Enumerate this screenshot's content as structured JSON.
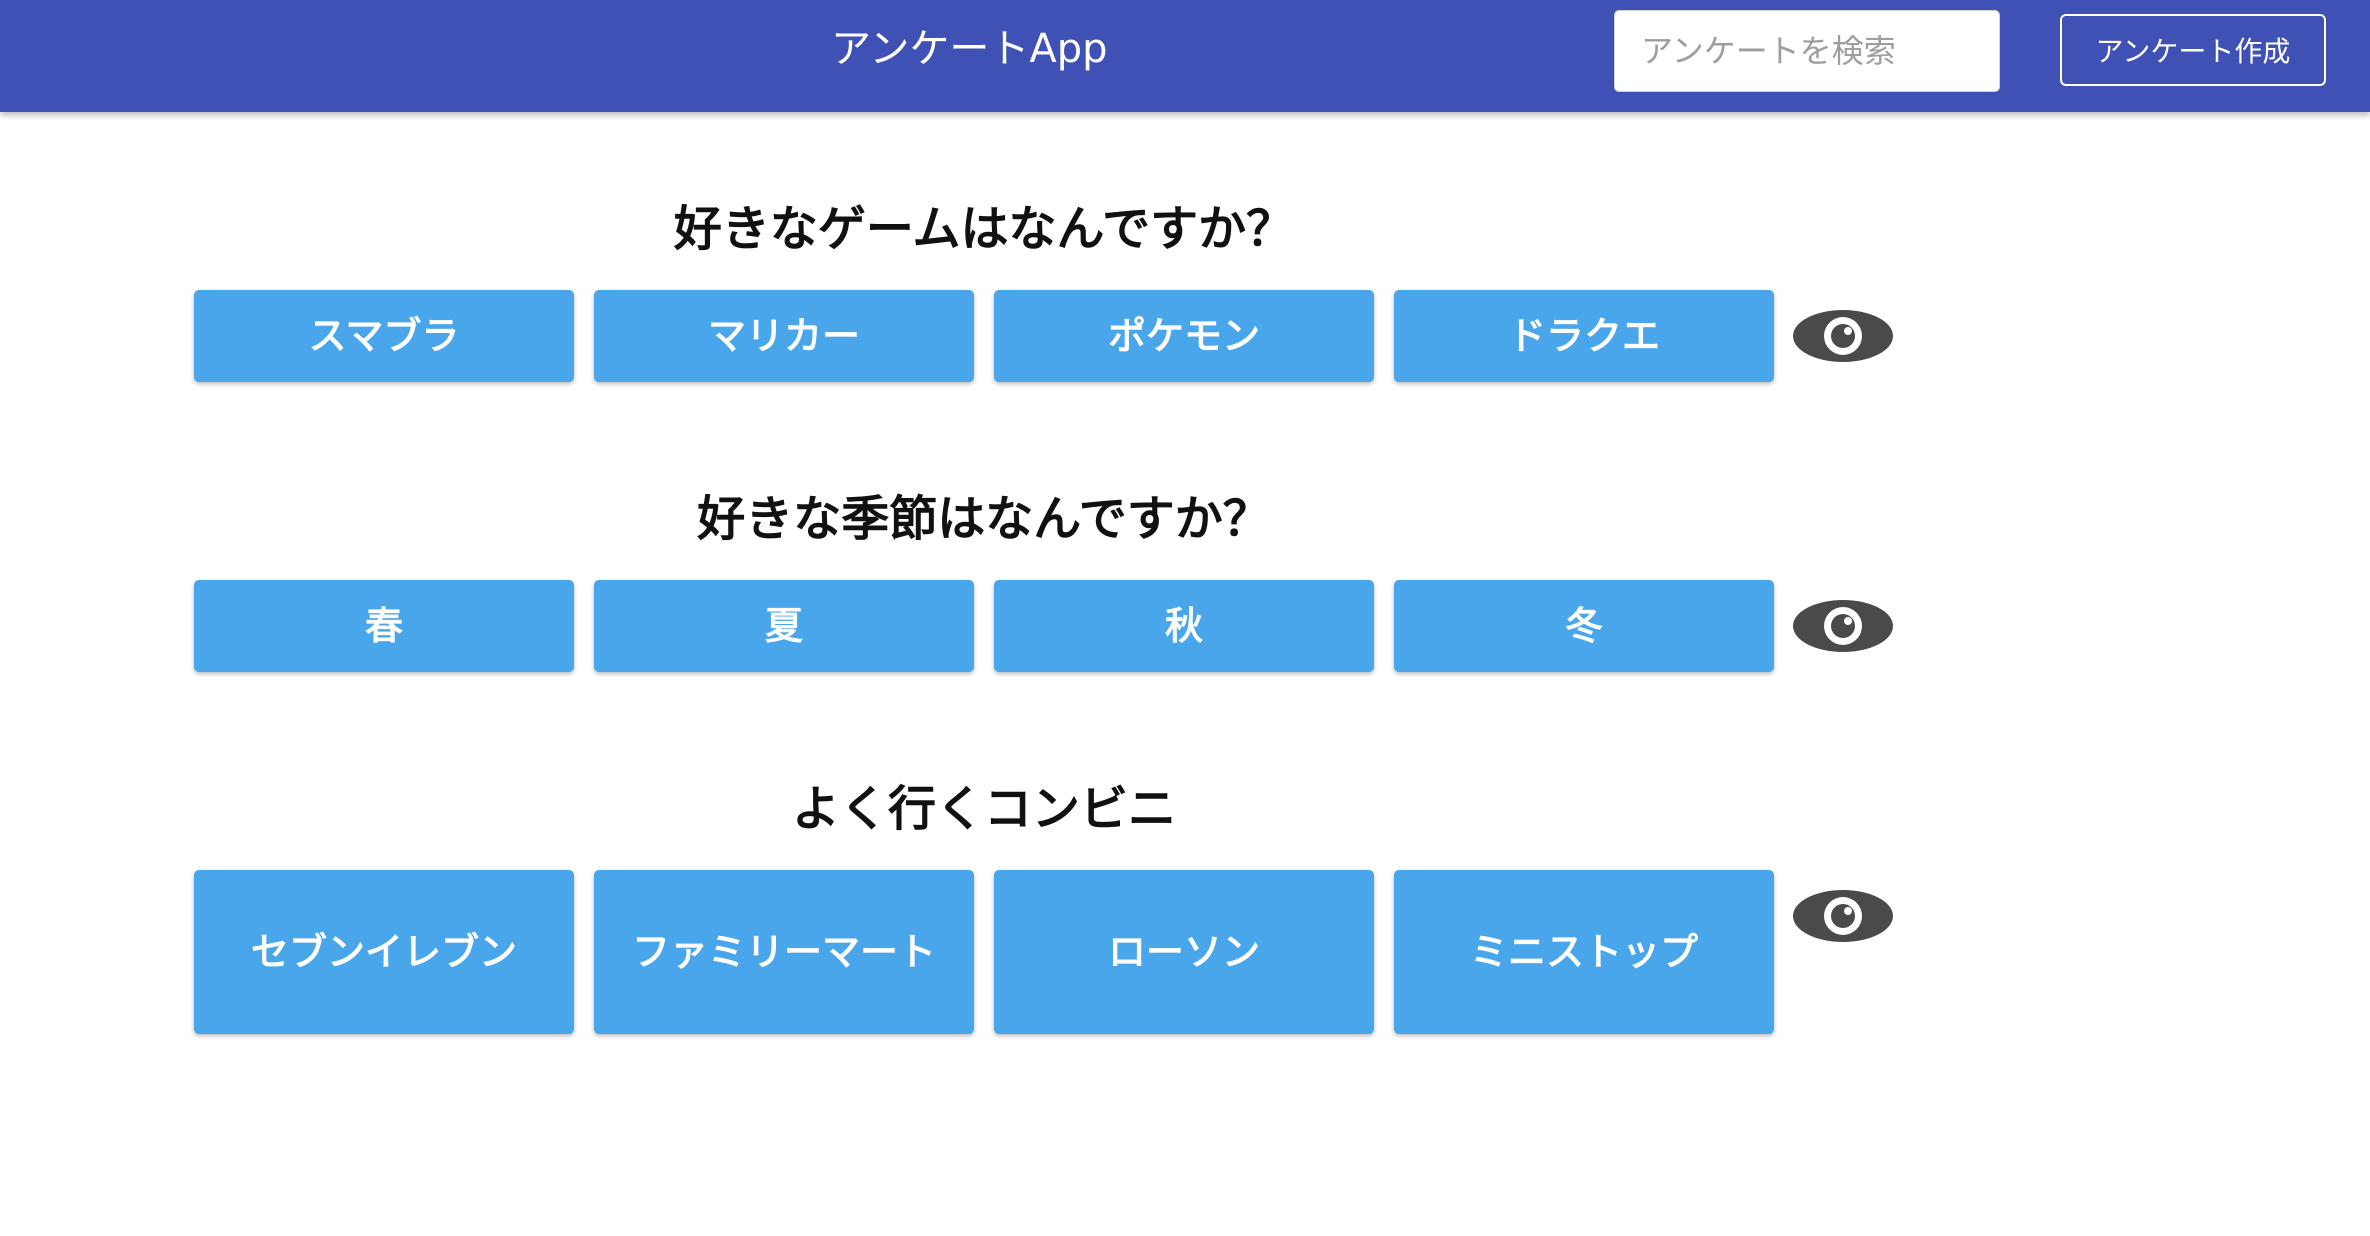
{
  "header": {
    "title": "アンケートApp",
    "search_placeholder": "アンケートを検索",
    "search_value": "",
    "create_label": "アンケート作成",
    "background_color": "#3f51b5"
  },
  "surveys": [
    {
      "question": "好きなゲームはなんですか？",
      "choices": [
        "スマブラ",
        "マリカー",
        "ポケモン",
        "ドラクエ"
      ],
      "view_icon": "eye-icon"
    },
    {
      "question": "好きな季節はなんですか？",
      "choices": [
        "春",
        "夏",
        "秋",
        "冬"
      ],
      "view_icon": "eye-icon"
    },
    {
      "question": "よく行くコンビニ",
      "choices": [
        "セブンイレブン",
        "ファミリーマート",
        "ローソン",
        "ミニストップ"
      ],
      "view_icon": "eye-icon"
    }
  ],
  "colors": {
    "choice_button": "#49a6ea",
    "eye_icon": "#4a4a4a"
  }
}
